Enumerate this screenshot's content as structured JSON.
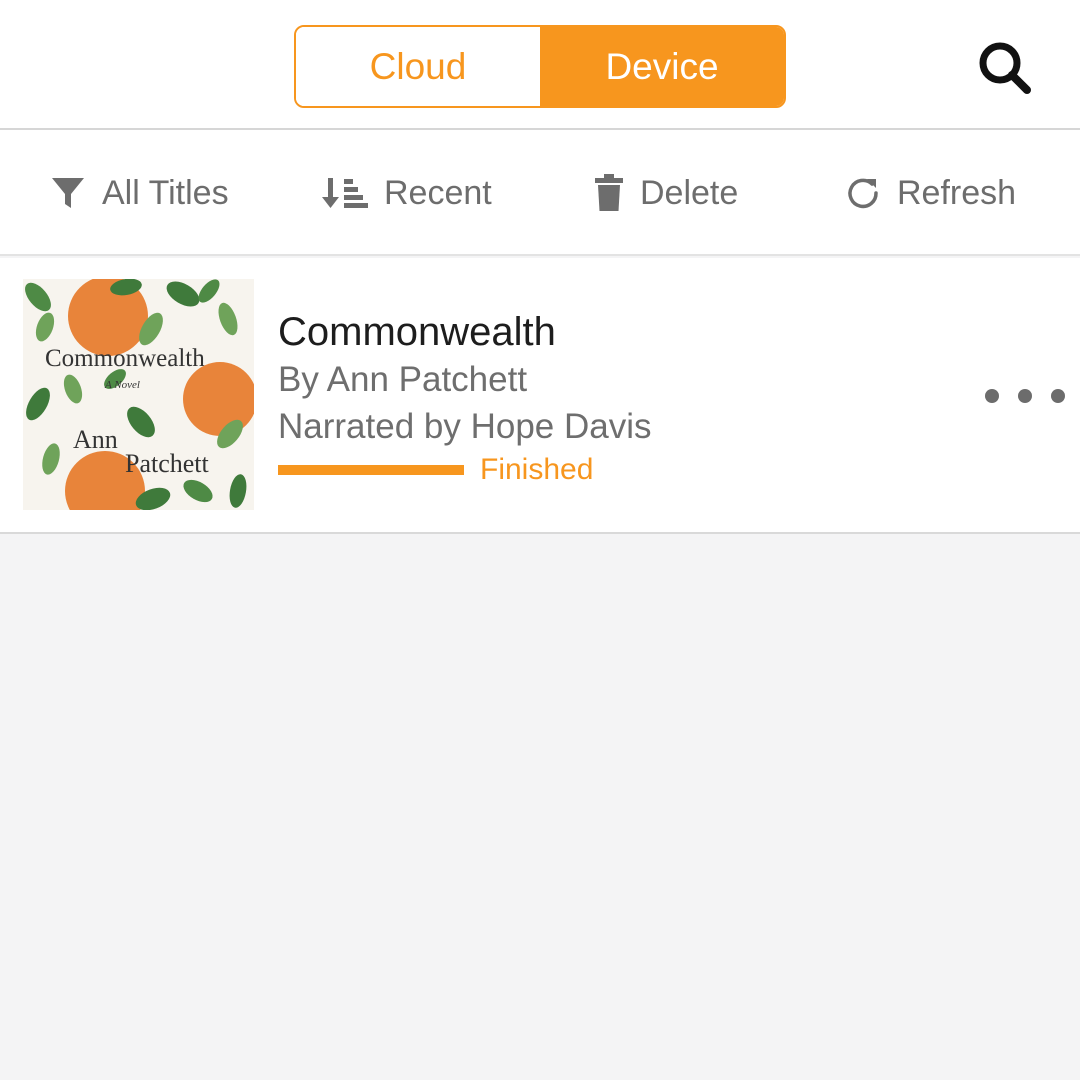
{
  "header": {
    "tabs": [
      {
        "label": "Cloud",
        "active": false
      },
      {
        "label": "Device",
        "active": true
      }
    ],
    "search_icon": "search-icon"
  },
  "toolbar": {
    "items": [
      {
        "label": "All Titles",
        "icon": "filter-icon"
      },
      {
        "label": "Recent",
        "icon": "sort-icon"
      },
      {
        "label": "Delete",
        "icon": "trash-icon"
      },
      {
        "label": "Refresh",
        "icon": "refresh-icon"
      }
    ]
  },
  "library": {
    "items": [
      {
        "title": "Commonwealth",
        "author": "By Ann Patchett",
        "narrator": "Narrated by Hope Davis",
        "status": "Finished",
        "progress": 1.0,
        "cover": {
          "title": "Commonwealth",
          "subtitle": "A Novel",
          "author_first": "Ann",
          "author_last": "Patchett"
        },
        "more_icon": "more-icon"
      }
    ]
  },
  "colors": {
    "accent": "#f7961e",
    "icon_gray": "#6d6d6d",
    "background": "#f4f4f5"
  }
}
